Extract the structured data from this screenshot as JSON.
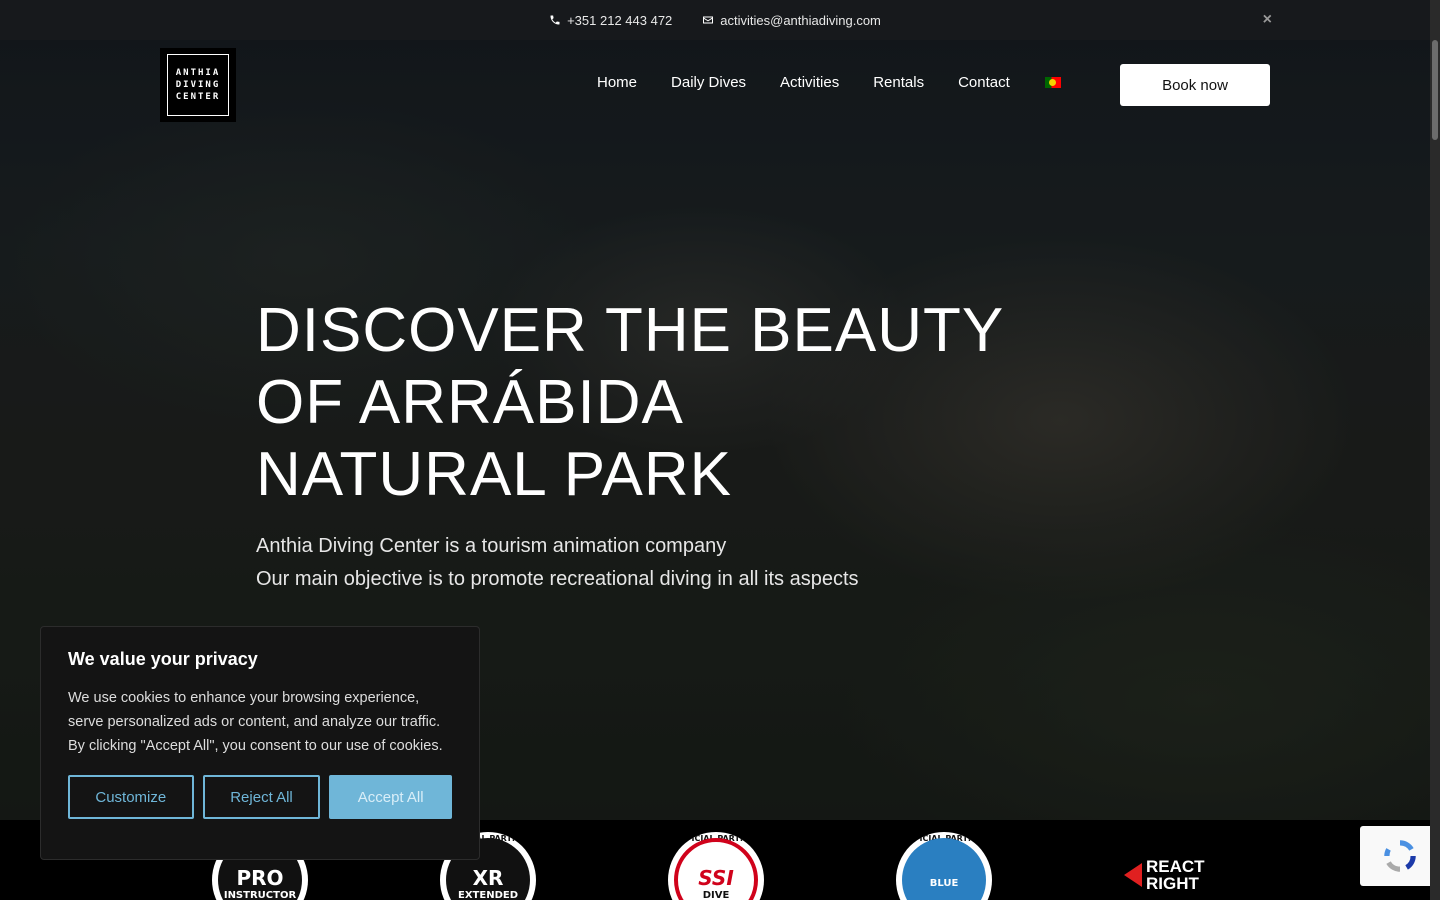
{
  "topbar": {
    "phone": "+351 212 443 472",
    "email": "activities@anthiadiving.com",
    "close_label": "×"
  },
  "logo": {
    "lines": [
      "ANTHIA",
      "DIVING",
      "CENTER"
    ]
  },
  "nav": {
    "items": [
      "Home",
      "Daily Dives",
      "Activities",
      "Rentals",
      "Contact"
    ],
    "language_flag": "pt-flag-icon",
    "book_label": "Book now"
  },
  "hero": {
    "title_lines": [
      "DISCOVER THE BEAUTY",
      "OF ARRÁBIDA",
      "NATURAL PARK"
    ],
    "subtitle_lines": [
      "Anthia Diving Center is a tourism animation company",
      "Our main objective is to promote recreational diving in all its aspects"
    ]
  },
  "cookie": {
    "title": "We value your privacy",
    "body": "We use cookies to enhance your browsing experience, serve personalized ads or content, and analyze our traffic. By clicking \"Accept All\", you consent to our use of cookies.",
    "customize_label": "Customize",
    "reject_label": "Reject All",
    "accept_label": "Accept All"
  },
  "partners": {
    "badges": [
      {
        "top": "",
        "mid": "PRO",
        "low": "INSTRUCTOR"
      },
      {
        "top": "OFFICIAL PARTNER",
        "mid": "XR",
        "low": "EXTENDED"
      },
      {
        "top": "OFFICIAL PARTNER",
        "mid": "SSI",
        "low": "DIVE"
      },
      {
        "top": "OFFICIAL PARTNER",
        "mid": "",
        "low": "BLUE"
      }
    ],
    "react_right": [
      "REACT",
      "RIGHT"
    ]
  },
  "colors": {
    "accent": "#6fb6d8",
    "topbar": "#17191c"
  }
}
